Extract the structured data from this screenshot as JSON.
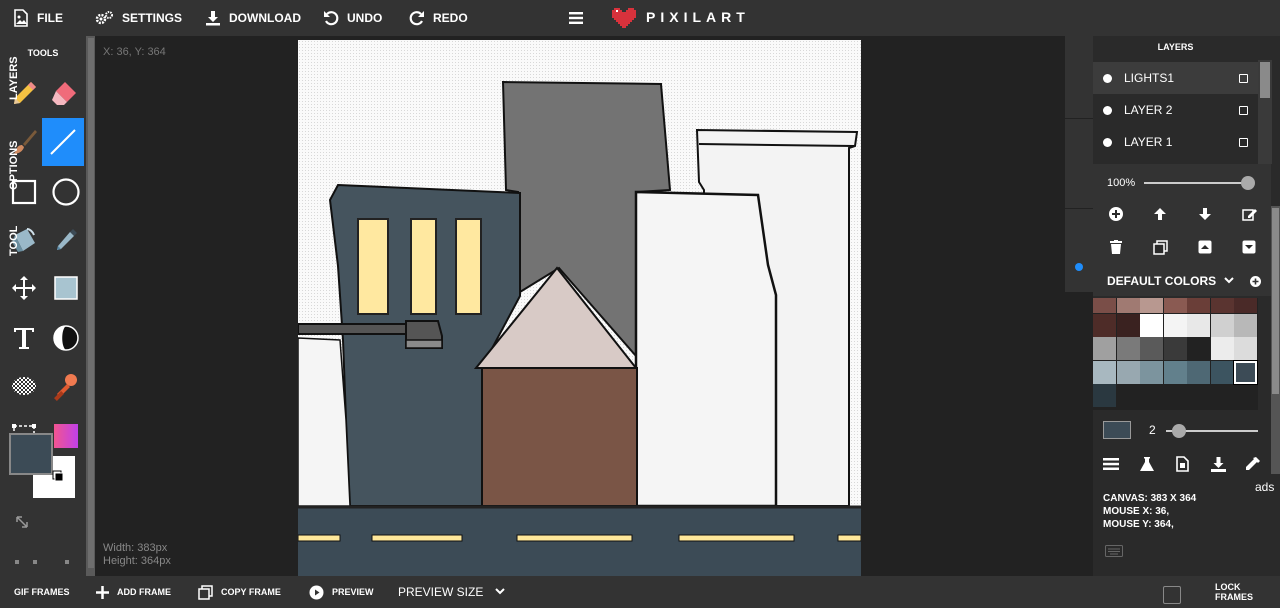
{
  "topbar": {
    "file": "FILE",
    "settings": "SETTINGS",
    "download": "DOWNLOAD",
    "undo": "UNDO",
    "redo": "REDO",
    "logo": "PIXILART"
  },
  "tools": {
    "title": "TOOLS",
    "items": [
      "pencil-icon",
      "eraser-icon",
      "brush-icon",
      "line-icon",
      "rectangle-icon",
      "circle-icon",
      "bucket-icon",
      "eyedropper-icon",
      "move-icon",
      "select-rect-icon",
      "text-icon",
      "shade-icon",
      "dither-icon",
      "stamp-icon",
      "crop-icon",
      "gradient-icon"
    ],
    "active": "line-icon",
    "primary_color": "#3c4b56",
    "secondary_color": "#ffffff"
  },
  "workspace": {
    "coords": "X: 36, Y: 364",
    "width_label": "Width: 383px",
    "height_label": "Height: 364px"
  },
  "sidetabs": [
    "LAYERS",
    "OPTIONS",
    "TOOL"
  ],
  "layers": {
    "title": "LAYERS",
    "items": [
      "LIGHTS1",
      "LAYER 2",
      "LAYER 1"
    ],
    "selected": "LIGHTS1",
    "opacity": "100%"
  },
  "colors": {
    "title": "DEFAULT COLORS",
    "palette": [
      "#7a4e48",
      "#a07a72",
      "#b89890",
      "#8a5a52",
      "#6a3e38",
      "#5a3430",
      "#4a2a28",
      "#4e2c28",
      "#3a2220",
      "#ffffff",
      "#f4f4f4",
      "#e8e8e8",
      "#d0d0d0",
      "#b8b8b8",
      "#a0a0a0",
      "#7a7a7a",
      "#5a5a5a",
      "#3a3a3a",
      "#222222",
      "#ececec",
      "#dcdcdc",
      "#a8b8c0",
      "#98a8b0",
      "#7c949e",
      "#62808c",
      "#4e6874",
      "#3c5460",
      "#3c4b56",
      "#2a3840"
    ],
    "selected_color": "#3c4b56"
  },
  "brush": {
    "color": "#3c4b56",
    "size": "2"
  },
  "info": {
    "canvas": "CANVAS: 383 X 364",
    "mouse_x": "MOUSE X: 36,",
    "mouse_y": "MOUSE Y: 364,",
    "ads": "ads"
  },
  "bottombar": {
    "gif_frames": "GIF FRAMES",
    "add_frame": "ADD FRAME",
    "copy_frame": "COPY FRAME",
    "preview": "PREVIEW",
    "preview_size": "PREVIEW SIZE",
    "lock_frames": "LOCK FRAMES"
  },
  "artwork": {
    "colors": {
      "road": "#3c4b56",
      "road_line": "#ffe89a",
      "building_blue": "#45545e",
      "window": "#ffe8a0",
      "tower_gray": "#737373",
      "roof": "#d8cac6",
      "house": "#7a5546",
      "white_building": "#f4f4f4"
    }
  }
}
